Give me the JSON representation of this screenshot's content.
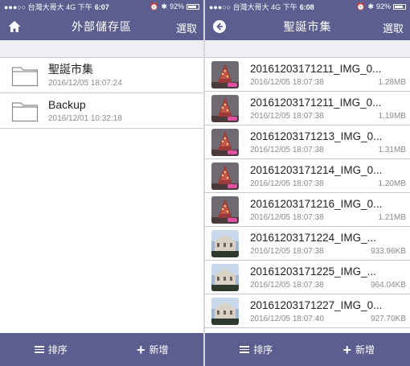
{
  "colors": {
    "bar": "#5b5e8e",
    "subbar": "#eeeef3",
    "divider": "#c9c9cf",
    "meta_text": "#8a8a8a"
  },
  "left": {
    "status": {
      "carrier": "●●●○○ 台灣大哥大 4G 下午",
      "time": "6:07",
      "battery": "92%"
    },
    "nav": {
      "title": "外部儲存區",
      "right_label": "選取",
      "left_icon": "home-icon"
    },
    "folders": [
      {
        "name": "聖誕市集",
        "date": "2016/12/05 18:07:24"
      },
      {
        "name": "Backup",
        "date": "2016/12/01 10:32:18"
      }
    ],
    "bottom": {
      "sort_label": "排序",
      "add_label": "新增"
    }
  },
  "right": {
    "status": {
      "carrier": "●●●○○ 台灣大哥大 4G 下午",
      "time": "6:08",
      "battery": "92%"
    },
    "nav": {
      "title": "聖誕市集",
      "right_label": "選取",
      "left_icon": "back-icon"
    },
    "files": [
      {
        "name": "20161203171211_IMG_0...",
        "date": "2016/12/05 18:07:38",
        "size": "1.28MB",
        "thumb": "tree"
      },
      {
        "name": "20161203171211_IMG_0...",
        "date": "2016/12/05 18:07:38",
        "size": "1.19MB",
        "thumb": "tree"
      },
      {
        "name": "20161203171213_IMG_0...",
        "date": "2016/12/05 18:07:38",
        "size": "1.31MB",
        "thumb": "tree"
      },
      {
        "name": "20161203171214_IMG_0...",
        "date": "2016/12/05 18:07:38",
        "size": "1.20MB",
        "thumb": "tree"
      },
      {
        "name": "20161203171216_IMG_0...",
        "date": "2016/12/05 18:07:38",
        "size": "1.21MB",
        "thumb": "tree"
      },
      {
        "name": "20161203171224_IMG_...",
        "date": "2016/12/05 18:07:38",
        "size": "933.96KB",
        "thumb": "building"
      },
      {
        "name": "20161203171225_IMG_...",
        "date": "2016/12/05 18:07:38",
        "size": "964.04KB",
        "thumb": "building"
      },
      {
        "name": "20161203171227_IMG_0...",
        "date": "2016/12/05 18:07:40",
        "size": "927.70KB",
        "thumb": "building"
      }
    ],
    "bottom": {
      "sort_label": "排序",
      "add_label": "新增"
    }
  }
}
